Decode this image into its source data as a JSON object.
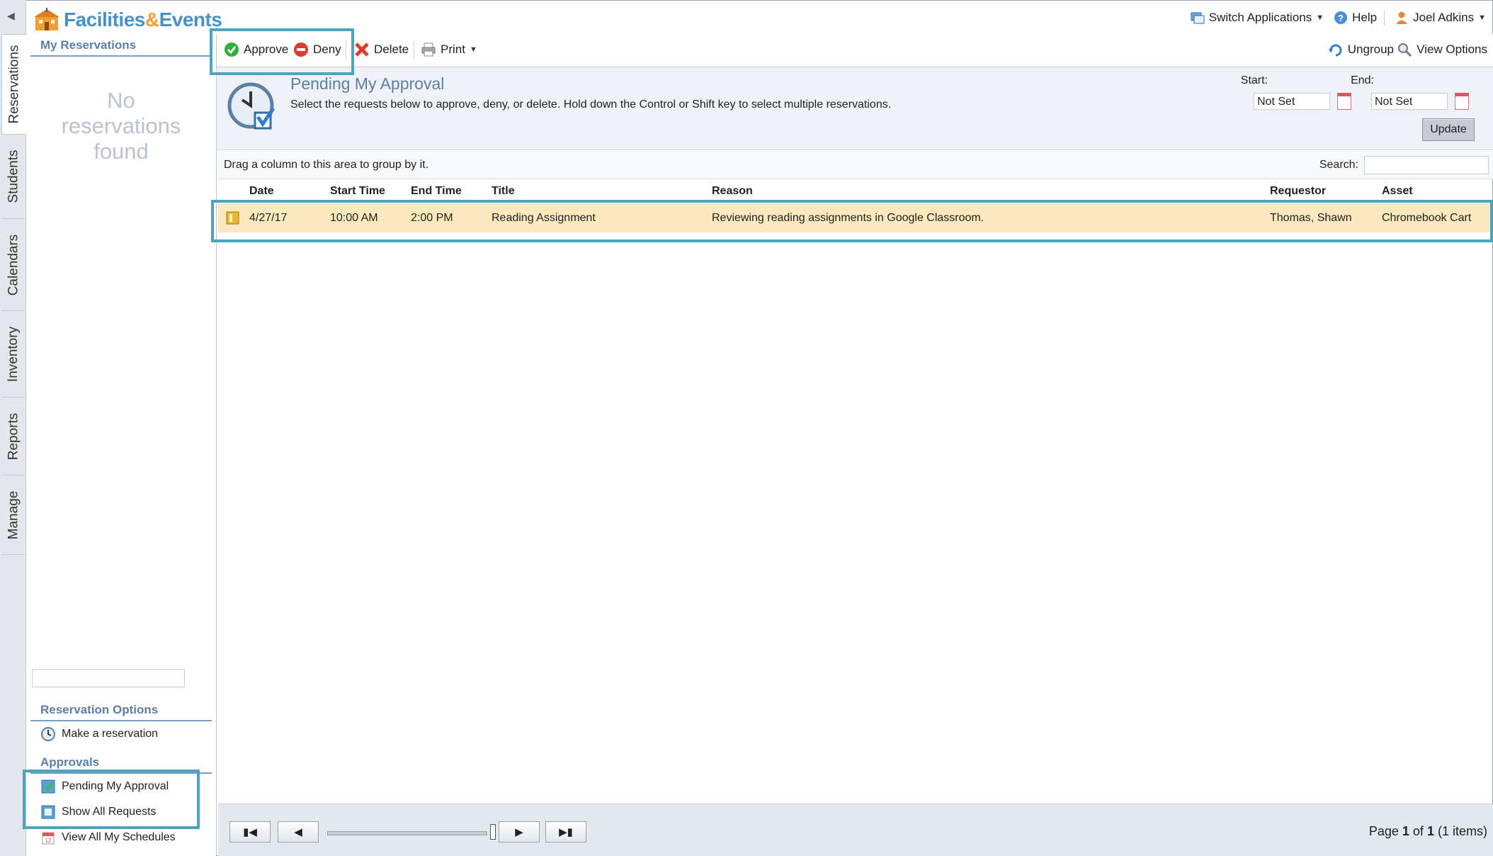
{
  "app": {
    "title_part1": "Facilities",
    "title_amp": "&",
    "title_part2": "Events"
  },
  "topbar": {
    "switch_apps": "Switch Applications",
    "help": "Help",
    "user": "Joel Adkins"
  },
  "vtabs": [
    "Reservations",
    "Students",
    "Calendars",
    "Inventory",
    "Reports",
    "Manage"
  ],
  "left": {
    "my_reservations": "My Reservations",
    "no_reservations": "No reservations found",
    "reservation_options": "Reservation Options",
    "make_reservation": "Make a reservation",
    "approvals": "Approvals",
    "pending": "Pending My Approval",
    "show_all": "Show All Requests",
    "view_schedules": "View All My Schedules"
  },
  "toolbar": {
    "approve": "Approve",
    "deny": "Deny",
    "delete": "Delete",
    "print": "Print",
    "ungroup": "Ungroup",
    "view_options": "View Options"
  },
  "header": {
    "title": "Pending My Approval",
    "description": "Select the requests below to approve, deny, or delete. Hold down the Control or Shift key to select multiple reservations.",
    "start_label": "Start:",
    "start_value": "Not Set",
    "end_label": "End:",
    "end_value": "Not Set",
    "update": "Update"
  },
  "grid": {
    "group_hint": "Drag a column to this area to group by it.",
    "search_label": "Search:",
    "columns": [
      "Date",
      "Start Time",
      "End Time",
      "Title",
      "Reason",
      "Requestor",
      "Asset"
    ],
    "rows": [
      [
        "4/27/17",
        "10:00 AM",
        "2:00 PM",
        "Reading Assignment",
        "Reviewing reading assignments in Google Classroom.",
        "Thomas, Shawn",
        "Chromebook Cart"
      ]
    ]
  },
  "pager": {
    "page_prefix": "Page",
    "page": "1",
    "of": "of",
    "total_pages": "1",
    "items": "(1 items)"
  },
  "colors": {
    "accent": "#4ba6bd",
    "selected_row": "#fbe9bd",
    "heading": "#5b7fa6"
  }
}
